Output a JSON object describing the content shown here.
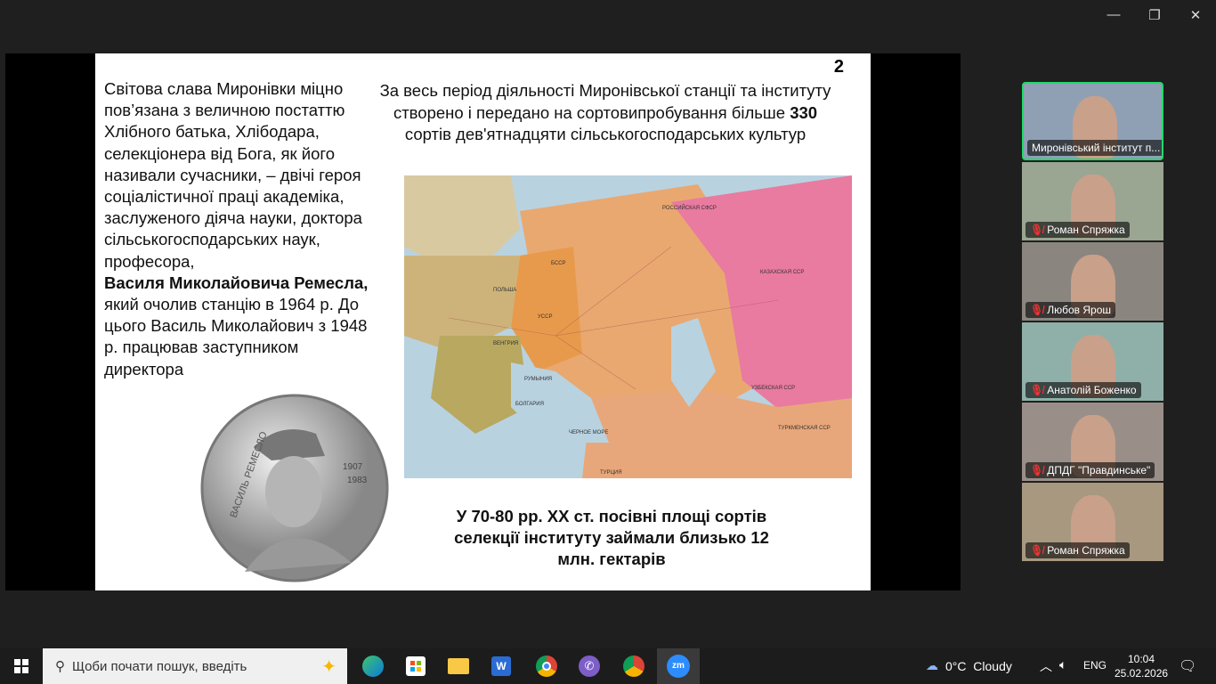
{
  "window": {
    "minimize": "—",
    "restore": "❐",
    "close": "✕"
  },
  "slide": {
    "page_number": "2",
    "left_text_1": "Світова слава Миронівки міцно пов’язана з величною постаттю Хлібного батька, Хлібодара, селекціонера від Бога, як його називали сучасники, – двічі героя соціалістичної праці академіка, заслуженого діяча науки, доктора сільськогосподарських наук, професора,",
    "left_name": "Василя Миколайовича Ремесла,",
    "left_text_2": "який очолив станцію в 1964 р. До цього Василь Миколайович з 1948 р. працював заступником директора",
    "right_text_1": "За весь період діяльності Миронівської станції та інституту створено і передано на сортовипробування більше ",
    "right_number": "330",
    "right_text_2": " сортів дев'ятнадцяти сільськогосподарських культур",
    "bottom_text": "У 70-80 рр. ХХ ст. посівні площі сортів селекції інституту займали близько 12 млн. гектарів",
    "coin": {
      "name": "ВАСИЛЬ РЕМЕСЛО",
      "years": [
        "1907",
        "1983"
      ]
    },
    "map_labels": [
      "РОССИЙСКАЯ СФСР",
      "КАЗАХСКАЯ ССР",
      "УССР",
      "БССР",
      "ПОЛЬША",
      "ВЕНГРИЯ",
      "РУМЫНИЯ",
      "БОЛГАРИЯ",
      "ЧЕРНОЕ МОРЕ",
      "УЗБЕКСКАЯ ССР",
      "ТУРКМЕНСКАЯ ССР",
      "ТУРЦИЯ"
    ]
  },
  "participants": [
    {
      "name": "Миронівський інститут п...",
      "muted": false,
      "active": true,
      "bg": "#8fa0b5"
    },
    {
      "name": "Роман Спряжка",
      "muted": true,
      "bg": "#9aa592"
    },
    {
      "name": "Любов Ярош",
      "muted": true,
      "bg": "#8b8580"
    },
    {
      "name": "Анатолій Боженко",
      "muted": true,
      "bg": "#8fb0a8"
    },
    {
      "name": "ДПДГ \"Правдинське\"",
      "muted": true,
      "bg": "#9a8f88"
    },
    {
      "name": "Роман Спряжка",
      "muted": true,
      "bg": "#a89880"
    }
  ],
  "taskbar": {
    "search_placeholder": "Щоби почати пошук, введіть",
    "weather": "0°C  Cloudy",
    "lang": "ENG",
    "time": "10:04",
    "date": "25.02.2026"
  }
}
